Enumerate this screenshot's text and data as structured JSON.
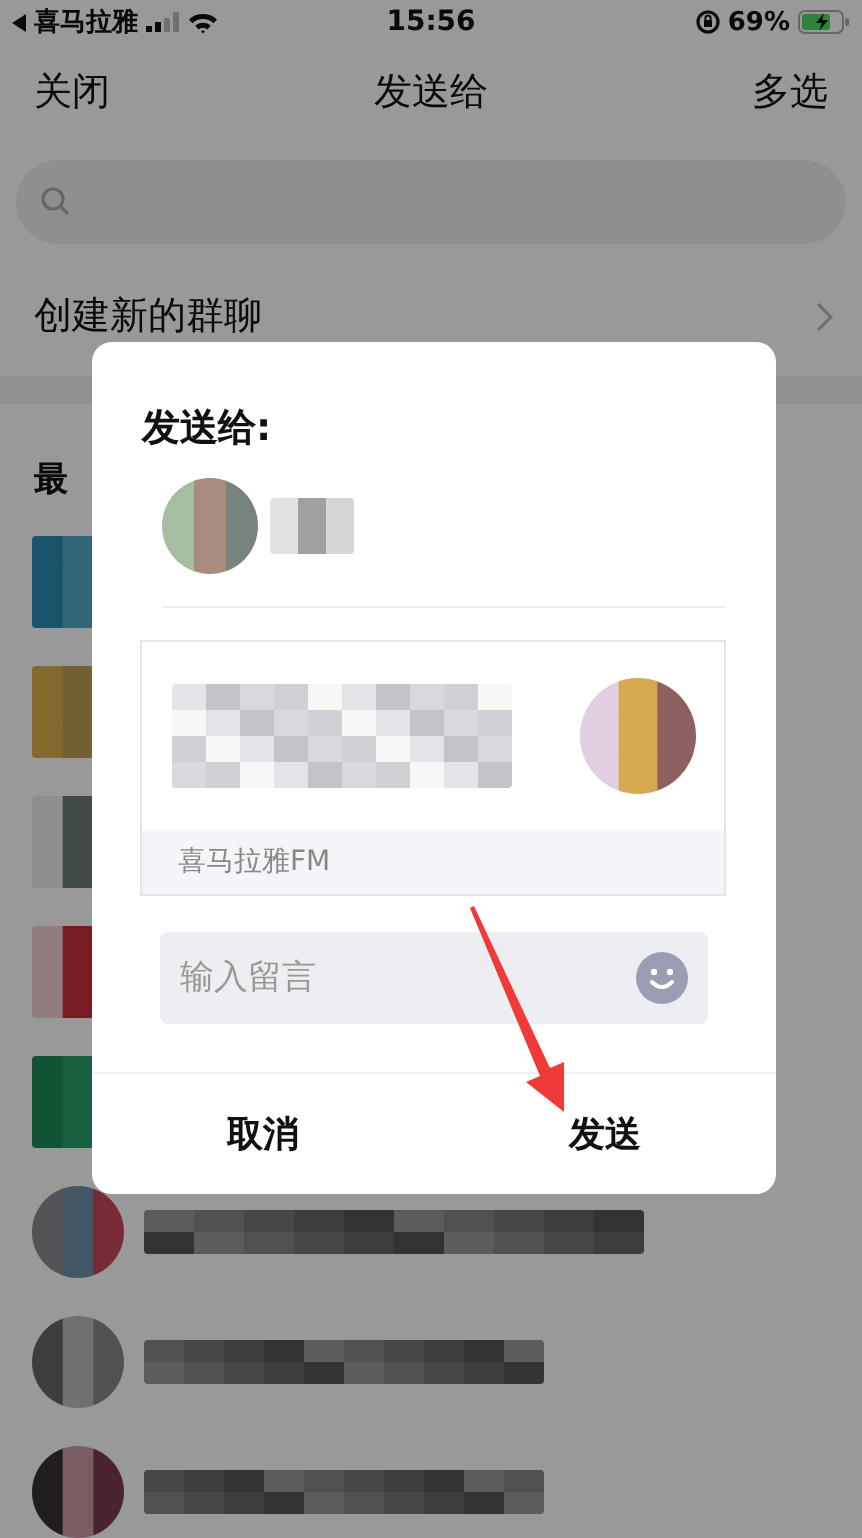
{
  "status_bar": {
    "carrier": "喜马拉雅",
    "time": "15:56",
    "battery": "69%"
  },
  "nav_bar": {
    "left": "关闭",
    "title": "发送给",
    "right": "多选"
  },
  "create_group": {
    "label": "创建新的群聊"
  },
  "recent": {
    "label": "最"
  },
  "dialog": {
    "title": "发送给:",
    "card": {
      "source": "喜马拉雅FM"
    },
    "message": {
      "placeholder": "输入留言"
    },
    "buttons": [
      "取消",
      "发送"
    ]
  }
}
